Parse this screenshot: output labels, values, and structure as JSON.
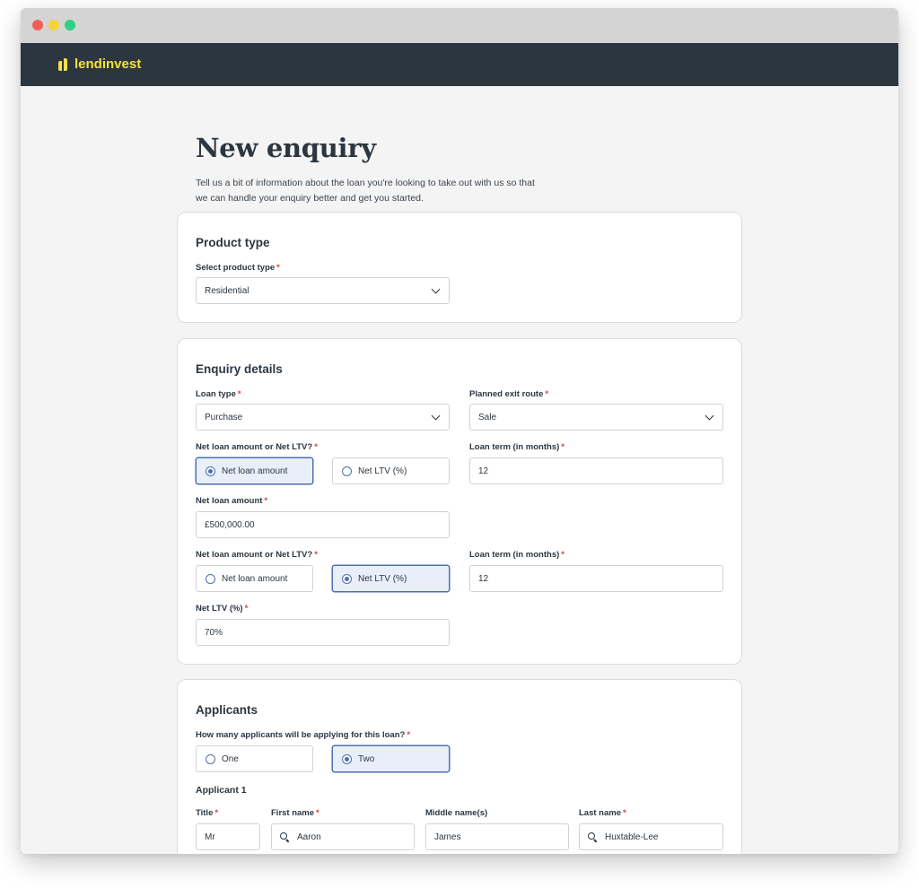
{
  "app": {
    "brand": "lendinvest"
  },
  "page": {
    "title": "New enquiry",
    "intro": "Tell us a bit of information about the loan you're looking to take out with us so that we can handle your enquiry better and get you started."
  },
  "product": {
    "heading": "Product type",
    "select_label": "Select product type",
    "select_value": "Residential"
  },
  "enquiry": {
    "heading": "Enquiry details",
    "loan_type_label": "Loan type",
    "loan_type_value": "Purchase",
    "exit_route_label": "Planned exit route",
    "exit_route_value": "Sale",
    "block1": {
      "choice_label": "Net loan amount or Net LTV?",
      "option_amount": "Net loan amount",
      "option_ltv": "Net LTV (%)",
      "selected": "amount",
      "term_label": "Loan term (in months)",
      "term_value": "12",
      "amount_label": "Net loan amount",
      "amount_value": "£500,000.00"
    },
    "block2": {
      "choice_label": "Net loan amount or Net LTV?",
      "option_amount": "Net loan amount",
      "option_ltv": "Net LTV (%)",
      "selected": "ltv",
      "term_label": "Loan term (in months)",
      "term_value": "12",
      "ltv_label": "Net LTV (%)",
      "ltv_value": "70%"
    }
  },
  "applicants": {
    "heading": "Applicants",
    "count_label": "How many applicants will be applying for this loan?",
    "option_one": "One",
    "option_two": "Two",
    "selected": "two",
    "applicant1": {
      "heading": "Applicant 1",
      "title_label": "Title",
      "title_value": "Mr",
      "first_label": "First name",
      "first_value": "Aaron",
      "middle_label": "Middle name(s)",
      "middle_value": "James",
      "last_label": "Last name",
      "last_value": "Huxtable-Lee"
    }
  },
  "colors": {
    "appbar": "#2c3640",
    "brand_yellow": "#f3e04b",
    "selected_blue": "#4b6fb1",
    "required_red": "#e0413c"
  }
}
